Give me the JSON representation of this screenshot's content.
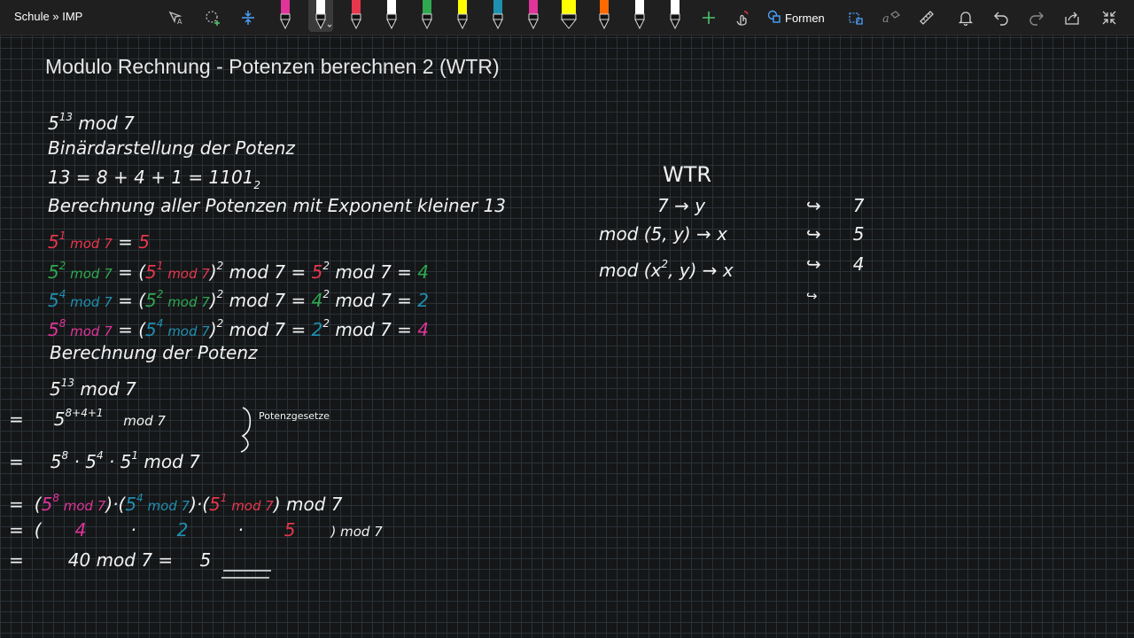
{
  "toolbar": {
    "breadcrumb": "Schule » IMP",
    "formen_label": "Formen",
    "icons": [
      "lasso-select-icon",
      "add-space-icon",
      "insert-space-icon",
      "pen-icon",
      "highlighter-icon",
      "add-pen-icon",
      "touch-draw-icon",
      "shapes-icon",
      "ink-to-shape-icon",
      "ink-to-math-icon",
      "ruler-icon",
      "bell-icon",
      "undo-icon",
      "redo-icon",
      "share-icon",
      "collapse-icon"
    ],
    "pen_colors": [
      "#e0349a",
      "#ffffff",
      "#e8364d",
      "#ffffff",
      "#2fa84f",
      "#ffff00",
      "#1f8fb0",
      "#e0349a",
      "#ffff00",
      "#ff6a00",
      "#ffffff",
      "#ffffff"
    ]
  },
  "page": {
    "title": "Modulo Rechnung - Potenzen berechnen 2 (WTR)"
  },
  "notes": {
    "l1": {
      "base": "5",
      "exp": "13",
      "rest": " mod 7"
    },
    "l2": "Binärdarstellung der Potenz",
    "l3": {
      "main": "13 = 8 + 4 + 1 = 1101",
      "sub": "2"
    },
    "l4": "Berechnung aller Potenzen mit Exponent kleiner 13",
    "l5": {
      "a": "5",
      "ae": "1",
      "b": " mod 7",
      "eq": " = ",
      "res": "5"
    },
    "l6": {
      "a": "5",
      "ae": "2",
      "b": " mod 7",
      "c": " = (",
      "d": "5",
      "de": "1",
      "e": " mod 7",
      "f": ")",
      "fe": "2",
      "g": " mod 7 = ",
      "h": "5",
      "he": "2",
      "i": " mod 7 = ",
      "res": "4"
    },
    "l7": {
      "a": "5",
      "ae": "4",
      "b": " mod 7",
      "c": " = (",
      "d": "5",
      "de": "2",
      "e": " mod 7",
      "f": ")",
      "fe": "2",
      "g": " mod 7 = ",
      "h": "4",
      "he": "2",
      "i": " mod 7 = ",
      "res": "2"
    },
    "l8": {
      "a": "5",
      "ae": "8",
      "b": " mod 7",
      "c": " = (",
      "d": "5",
      "de": "4",
      "e": " mod 7",
      "f": ")",
      "fe": "2",
      "g": " mod 7 = ",
      "h": "2",
      "he": "2",
      "i": " mod 7 = ",
      "res": "4"
    },
    "l9": "Berechnung der Potenz",
    "l10": {
      "base": "5",
      "exp": "13",
      "rest": " mod 7"
    },
    "l11": {
      "eq": "=",
      "base": "5",
      "exp": "8+4+1",
      "rest": " mod 7"
    },
    "l11_note": "Potenzgesetze",
    "l12": {
      "eq": "=",
      "a": "5",
      "ae": "8",
      "b": " · 5",
      "be": "4",
      "c": " · 5",
      "ce": "1",
      "d": " mod 7"
    },
    "l13": {
      "eq": "=",
      "o": "(",
      "a": "5",
      "ae": "8",
      "am": " mod 7",
      "c1": ")·(",
      "b": "5",
      "be": "4",
      "bm": " mod 7",
      "c2": ")·(",
      "c": "5",
      "ce": "1",
      "cm": " mod 7",
      "c3": ") mod 7"
    },
    "l14": {
      "eq": "=",
      "o": "(",
      "a": "4",
      "d1": "·",
      "b": "2",
      "d2": "·",
      "c": "5",
      "cl": ") mod 7"
    },
    "l15": {
      "eq": "=",
      "expr": "40 mod 7 = ",
      "res": "5"
    }
  },
  "wtr": {
    "title": "WTR",
    "r1": {
      "left": "7 → y",
      "arrow": "↪",
      "val": "7"
    },
    "r2": {
      "left": "mod (5, y) → x",
      "arrow": "↪",
      "val": "5"
    },
    "r3": {
      "left": "mod (x",
      "sup": "2",
      "rest": ", y) → x",
      "arrow": "↪",
      "val": "4"
    },
    "r4": {
      "arrow": "↪"
    }
  }
}
